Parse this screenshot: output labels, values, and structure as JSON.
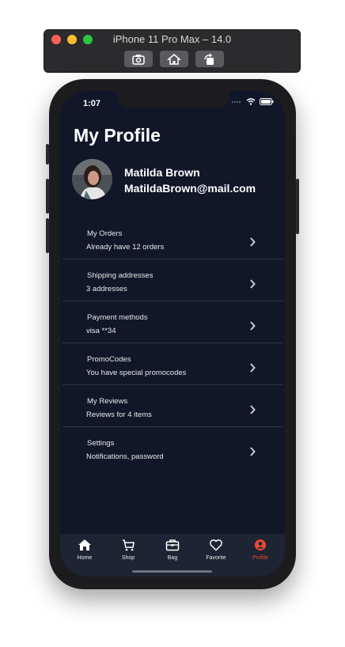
{
  "window": {
    "title": "iPhone 11 Pro Max – 14.0",
    "buttons": [
      "screenshot-icon",
      "home-icon",
      "rotate-icon"
    ]
  },
  "status_bar": {
    "time": "1:07"
  },
  "page": {
    "title": "My Profile"
  },
  "user": {
    "name": "Matilda Brown",
    "email": "MatildaBrown@mail.com"
  },
  "menu": {
    "items": [
      {
        "title": "My Orders",
        "subtitle": "Already have 12 orders"
      },
      {
        "title": "Shipping addresses",
        "subtitle": "3 addresses"
      },
      {
        "title": "Payment methods",
        "subtitle": "visa **34"
      },
      {
        "title": "PromoCodes",
        "subtitle": "You have special promocodes"
      },
      {
        "title": "My Reviews",
        "subtitle": "Reviews for 4 items"
      },
      {
        "title": "Settings",
        "subtitle": "Notifications, password"
      }
    ]
  },
  "tab_bar": {
    "items": [
      {
        "label": "Home",
        "icon": "home-icon"
      },
      {
        "label": "Shop",
        "icon": "cart-icon"
      },
      {
        "label": "Bag",
        "icon": "bag-icon"
      },
      {
        "label": "Favorite",
        "icon": "heart-icon"
      },
      {
        "label": "Profile",
        "icon": "profile-icon"
      }
    ],
    "active": "Profile"
  },
  "colors": {
    "background": "#111729",
    "tab_bar": "#1e2433",
    "accent": "#e84a34",
    "text": "#ffffff"
  }
}
